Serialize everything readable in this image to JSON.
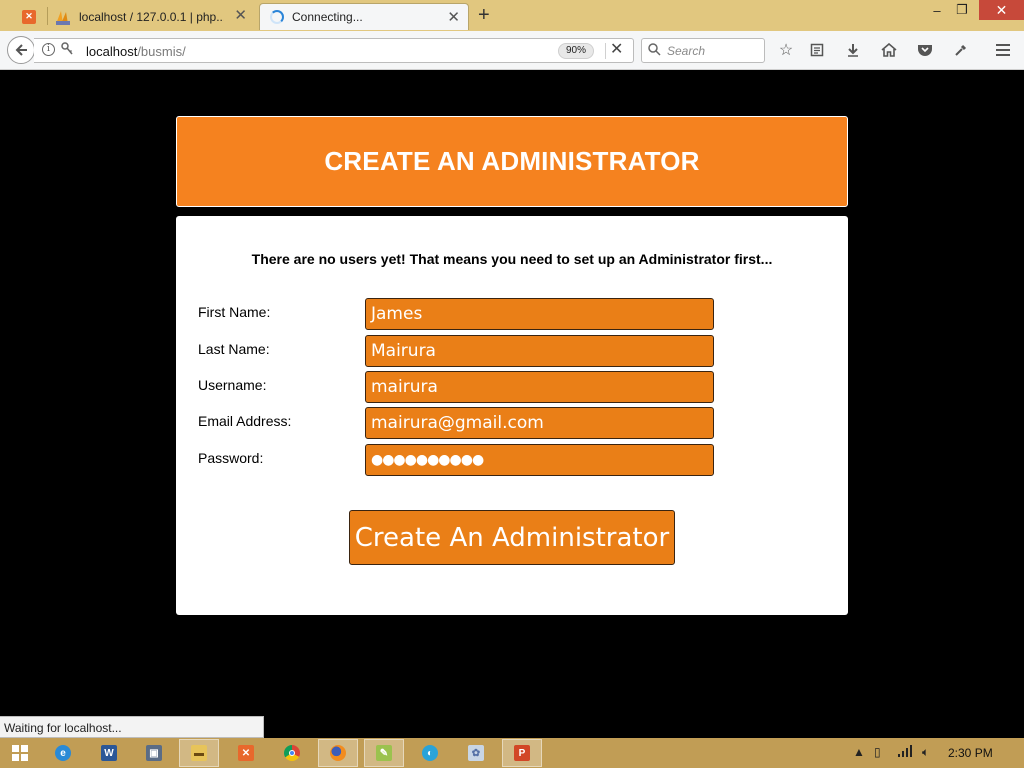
{
  "browser": {
    "tabs": [
      {
        "label": "localhost / 127.0.0.1 | php...",
        "icon": "phpmyadmin-icon",
        "active": false
      },
      {
        "label": "Connecting...",
        "icon": "loading-spinner-icon",
        "active": true
      }
    ],
    "url": {
      "host": "localhost",
      "path": "/busmis/"
    },
    "zoom": "90%",
    "search_placeholder": "Search"
  },
  "page": {
    "header_title": "CREATE AN ADMINISTRATOR",
    "intro": "There are no users yet! That means you need to set up an Administrator first...",
    "fields": [
      {
        "label": "First Name:",
        "value": "James"
      },
      {
        "label": "Last Name:",
        "value": "Mairura"
      },
      {
        "label": "Username:",
        "value": "mairura"
      },
      {
        "label": "Email Address:",
        "value": "mairura@gmail.com"
      },
      {
        "label": "Password:",
        "value": "●●●●●●●●●●"
      }
    ],
    "submit_label": "Create An Administrator"
  },
  "status_text": "Waiting for localhost...",
  "taskbar": {
    "clock": "2:30 PM"
  },
  "colors": {
    "accent_orange": "#f5821f",
    "input_orange": "#ea7f17",
    "page_background": "#000000",
    "tabstrip": "#e1c77f",
    "taskbar": "#c19d55"
  }
}
